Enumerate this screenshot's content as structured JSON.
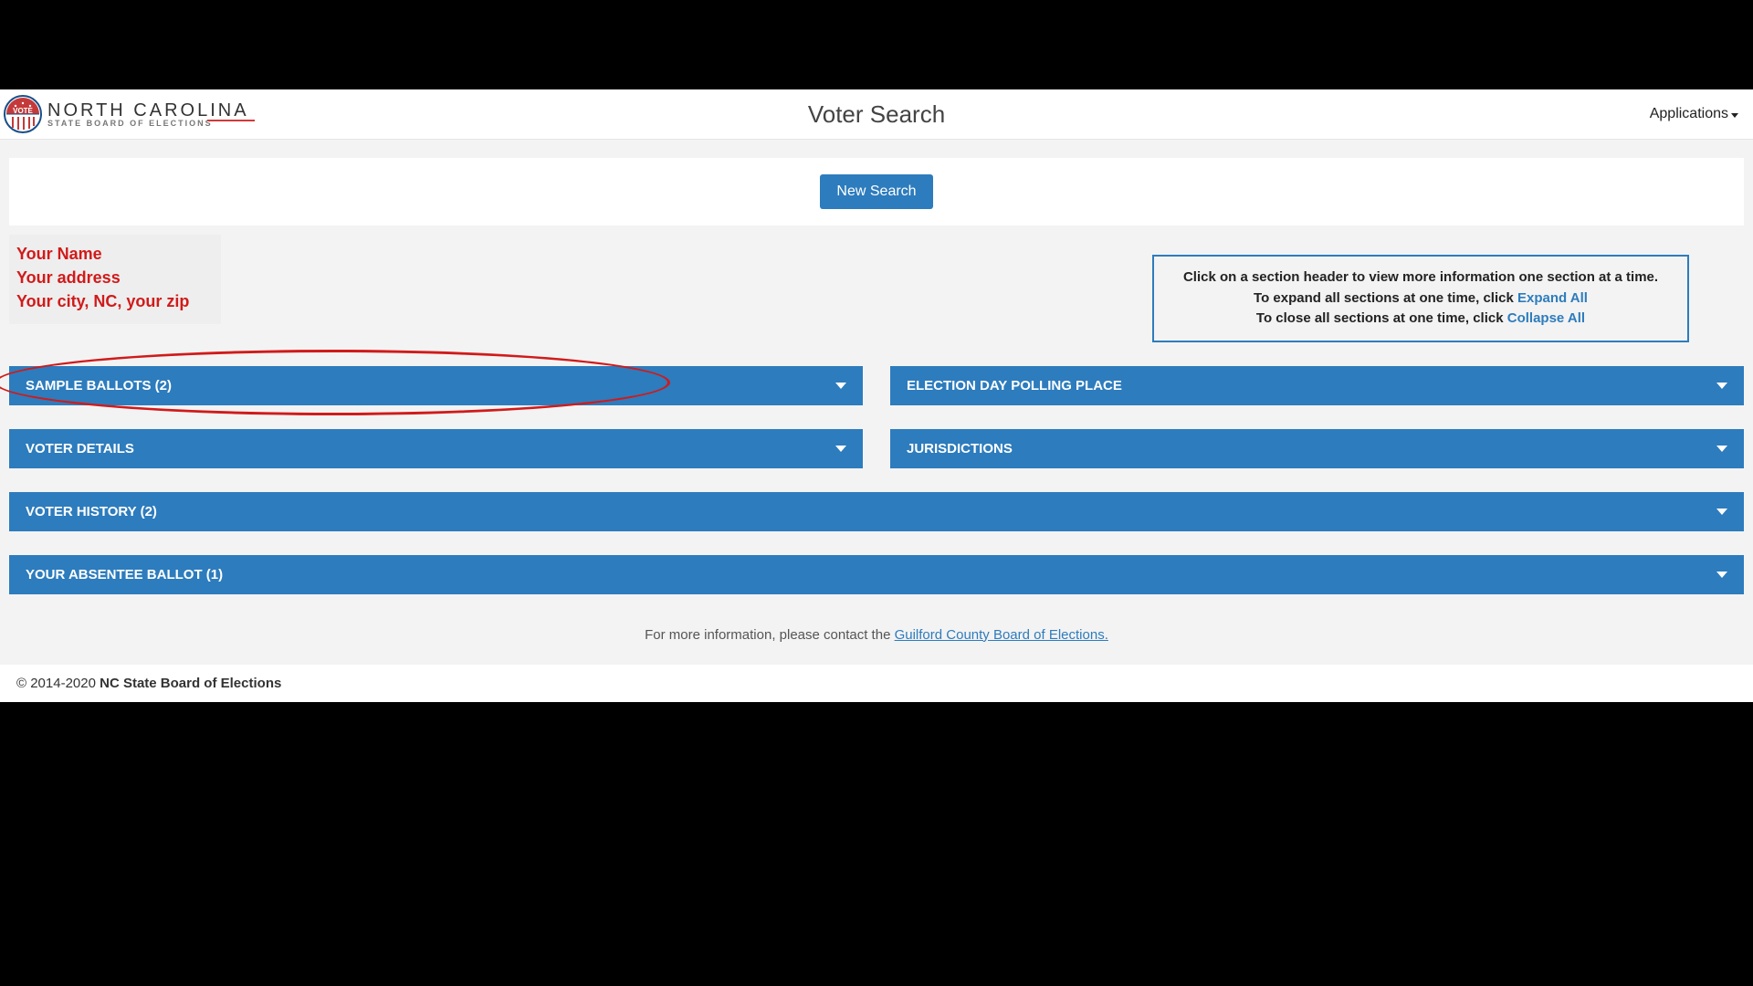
{
  "header": {
    "logo_title": "NORTH CAROLINA",
    "logo_sub": "STATE BOARD OF ELECTIONS",
    "page_title": "Voter Search",
    "apps_label": "Applications"
  },
  "actions": {
    "new_search": "New Search"
  },
  "voter": {
    "name": "Your Name",
    "address": "Your address",
    "city_line": "Your city, NC, your zip"
  },
  "hint": {
    "line1": "Click on a section header to view more information one section at a time.",
    "line2a": "To expand all sections at one time, click ",
    "expand": "Expand All",
    "line3a": "To close all sections at one time, click ",
    "collapse": "Collapse All"
  },
  "panels": {
    "sample_ballots": "SAMPLE BALLOTS (2)",
    "polling_place": "ELECTION DAY POLLING PLACE",
    "voter_details": "VOTER DETAILS",
    "jurisdictions": "JURISDICTIONS",
    "voter_history": "VOTER HISTORY (2)",
    "absentee": "YOUR ABSENTEE BALLOT (1)"
  },
  "more_info": {
    "prefix": "For more information, please contact the ",
    "link": "Guilford County Board of Elections."
  },
  "footer": {
    "copyright": "© 2014-2020 ",
    "org": "NC State Board of Elections"
  }
}
